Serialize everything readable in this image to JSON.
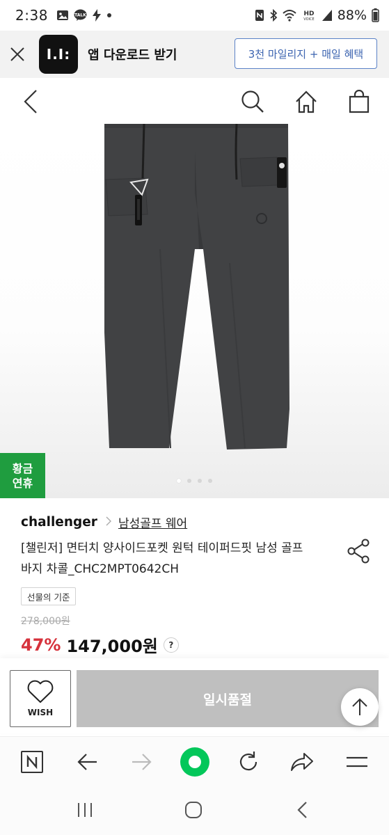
{
  "status_bar": {
    "time": "2:38",
    "battery": "88%",
    "icons": [
      "gallery-icon",
      "kakaotalk-icon",
      "bolt-icon",
      "dot-icon",
      "nfc-icon",
      "bluetooth-icon",
      "wifi-icon",
      "hd-voice-icon",
      "signal-icon",
      "battery-icon"
    ],
    "hd_label": "HD"
  },
  "app_banner": {
    "logo_text": "I.I:",
    "title": "앱 다운로드 받기",
    "cta_label": "3천 마일리지 + 매일 혜택"
  },
  "header": {
    "icons": [
      "back-icon",
      "search-icon",
      "home-icon",
      "shopping-bag-icon"
    ]
  },
  "gallery": {
    "slide_count": 4,
    "active_index": 0,
    "promo_badge": [
      "황금",
      "연휴"
    ]
  },
  "product": {
    "brand": "challenger",
    "category": "남성골프 웨어",
    "title": "[챌린저] 면터치 양사이드포켓 원턱 테이퍼드핏 남성 골프바지 차콜_CHC2MPT0642CH",
    "gift_chip": "선물의 기준",
    "original_price": "278,000원",
    "discount": "47%",
    "sale_price": "147,000원",
    "help": "?"
  },
  "purchase_bar": {
    "wish_label": "WISH",
    "soldout_label": "일시품절"
  },
  "browser_toolbar": {
    "icons": [
      "naver-n-icon",
      "back-arrow-icon",
      "forward-arrow-icon",
      "green-dot-icon",
      "refresh-icon",
      "share-arrow-icon",
      "menu-icon"
    ]
  },
  "system_nav": {
    "icons": [
      "recents-icon",
      "home-circle-icon",
      "back-chevron-icon"
    ]
  },
  "colors": {
    "discount": "#d6323c",
    "promo_badge": "#1f9d3f",
    "banner_cta": "#3c64b0",
    "soldout": "#bfbfbf",
    "naver_green": "#03c75a"
  }
}
